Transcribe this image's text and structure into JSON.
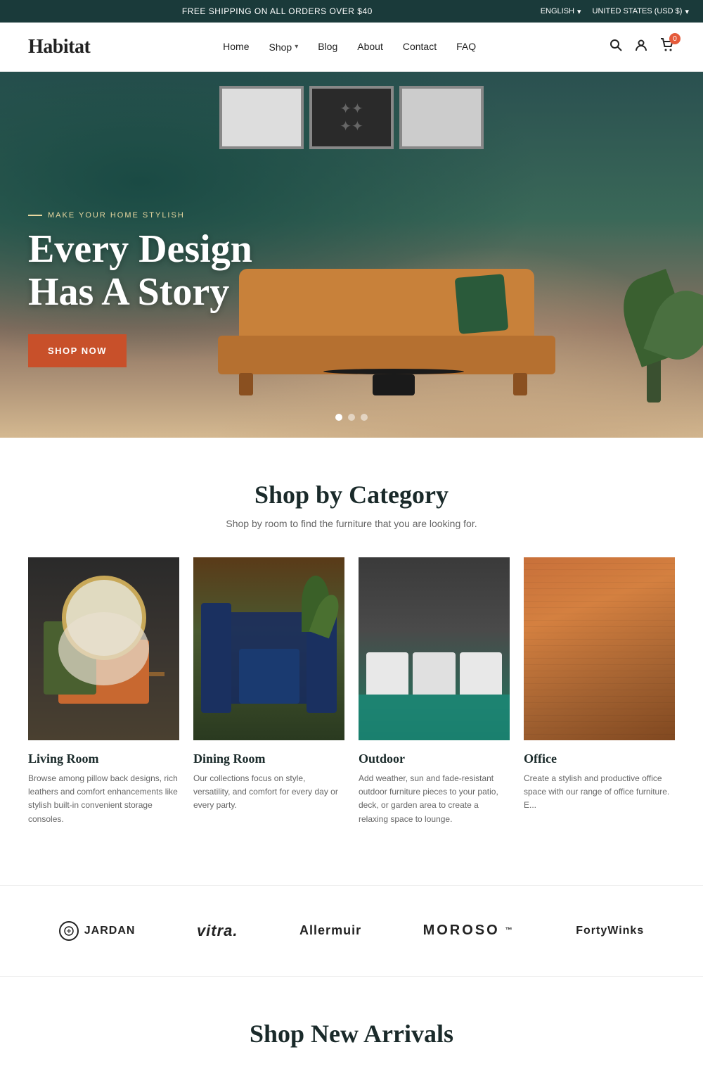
{
  "topbar": {
    "announcement": "FREE SHIPPING ON ALL ORDERS OVER $40",
    "language": "ENGLISH",
    "currency": "UNITED STATES (USD $)"
  },
  "header": {
    "logo": "Habitat",
    "nav": [
      {
        "label": "Home",
        "hasDropdown": false
      },
      {
        "label": "Shop",
        "hasDropdown": true
      },
      {
        "label": "Blog",
        "hasDropdown": false
      },
      {
        "label": "About",
        "hasDropdown": false
      },
      {
        "label": "Contact",
        "hasDropdown": false
      },
      {
        "label": "FAQ",
        "hasDropdown": false
      }
    ],
    "cart_count": "0"
  },
  "hero": {
    "eyebrow": "MAKE YOUR HOME STYLISH",
    "title": "Every Design Has A Story",
    "cta_label": "SHOP NOW",
    "dots": [
      {
        "active": true
      },
      {
        "active": false
      },
      {
        "active": false
      }
    ]
  },
  "shop_by_category": {
    "title": "Shop by Category",
    "subtitle": "Shop by room to find the furniture that you are looking for.",
    "categories": [
      {
        "name": "Living Room",
        "description": "Browse among pillow back designs, rich leathers and comfort enhancements like stylish built-in convenient storage consoles."
      },
      {
        "name": "Dining Room",
        "description": "Our collections focus on style, versatility, and comfort for every day or every party."
      },
      {
        "name": "Outdoor",
        "description": "Add weather, sun and fade-resistant outdoor furniture pieces to your patio, deck, or garden area to create a relaxing space to lounge."
      },
      {
        "name": "Office",
        "description": "Create a stylish and productive office space with our range of office furniture. E..."
      }
    ]
  },
  "brands": {
    "items": [
      {
        "name": "JARDAN",
        "class": "brand-jardan",
        "hasIcon": true
      },
      {
        "name": "vitra.",
        "class": "brand-vitra"
      },
      {
        "name": "Allermuir",
        "class": "brand-allermuir"
      },
      {
        "name": "MOROSO",
        "class": "brand-moroso",
        "superscript": "™"
      },
      {
        "name": "FortyWinks",
        "class": "brand-fortywinks"
      }
    ]
  },
  "new_arrivals": {
    "title": "Shop New Arrivals"
  }
}
